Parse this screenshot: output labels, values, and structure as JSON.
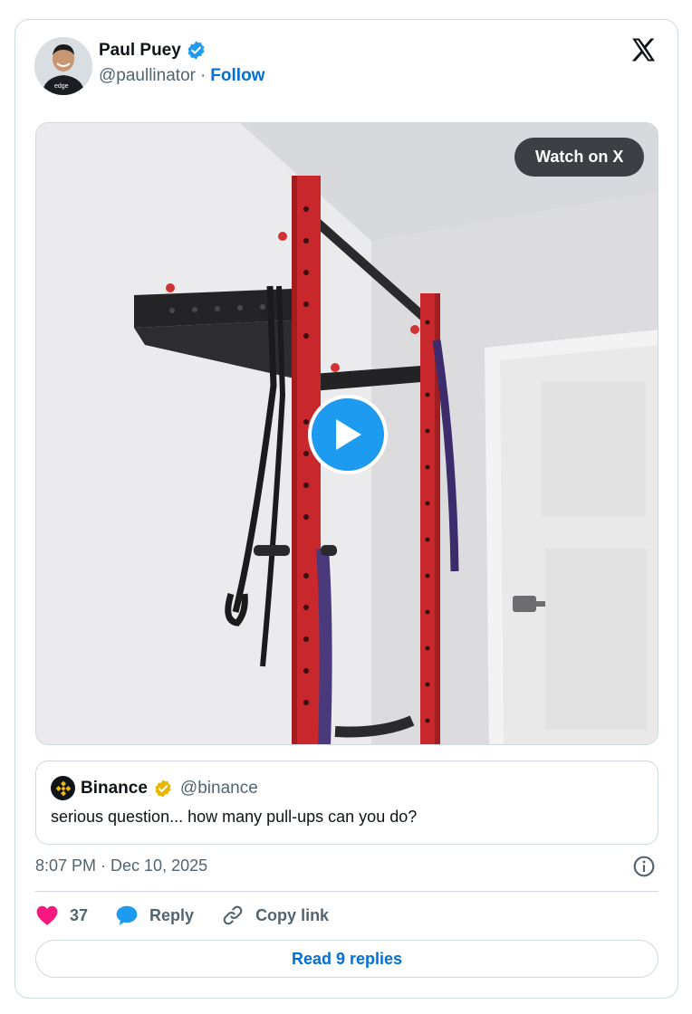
{
  "author": {
    "name": "Paul Puey",
    "handle": "@paullinator",
    "separator": "·",
    "follow_label": "Follow",
    "avatar_shirt_text": "edge",
    "verified_color": "#1d9bf0"
  },
  "media": {
    "watch_label": "Watch on X",
    "play_color": "#1d9bf0",
    "rack_color": "#c8282b"
  },
  "quote": {
    "name": "Binance",
    "handle": "@binance",
    "text": "serious question... how many pull-ups can you do?",
    "badge_color": "#e9b600",
    "logo_color": "#f0b90b"
  },
  "meta": {
    "timestamp": "8:07 PM · Dec 10, 2025"
  },
  "actions": {
    "like_count": "37",
    "reply_label": "Reply",
    "copy_label": "Copy link",
    "like_color": "#f91880",
    "reply_color": "#1d9bf0"
  },
  "footer": {
    "read_replies_label": "Read 9 replies"
  }
}
